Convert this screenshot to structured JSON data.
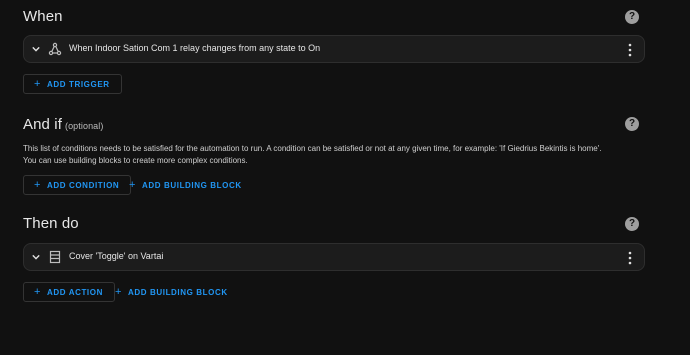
{
  "when": {
    "title": "When",
    "help_icon": "question-mark-circle-icon",
    "trigger": {
      "icon": "state-trigger-icon",
      "text": "When Indoor Sation Com 1 relay changes from any state to On"
    },
    "add_trigger_label": "ADD TRIGGER"
  },
  "and_if": {
    "title": "And if",
    "optional_label": "(optional)",
    "help_icon": "question-mark-circle-icon",
    "description_line1": "This list of conditions needs to be satisfied for the automation to run. A condition can be satisfied or not at any given time, for example: 'If Giedrius Bekintis is home'.",
    "description_line2": "You can use building blocks to create more complex conditions.",
    "add_condition_label": "ADD CONDITION",
    "add_building_block_label": "ADD BUILDING BLOCK"
  },
  "then_do": {
    "title": "Then do",
    "help_icon": "question-mark-circle-icon",
    "action": {
      "icon": "cover-icon",
      "text": "Cover 'Toggle' on Vartai"
    },
    "add_action_label": "ADD ACTION",
    "add_building_block_label": "ADD BUILDING BLOCK"
  },
  "colors": {
    "background": "#111111",
    "card": "#1c1c1c",
    "accent": "#2196f3",
    "text": "#e1e1e1"
  }
}
